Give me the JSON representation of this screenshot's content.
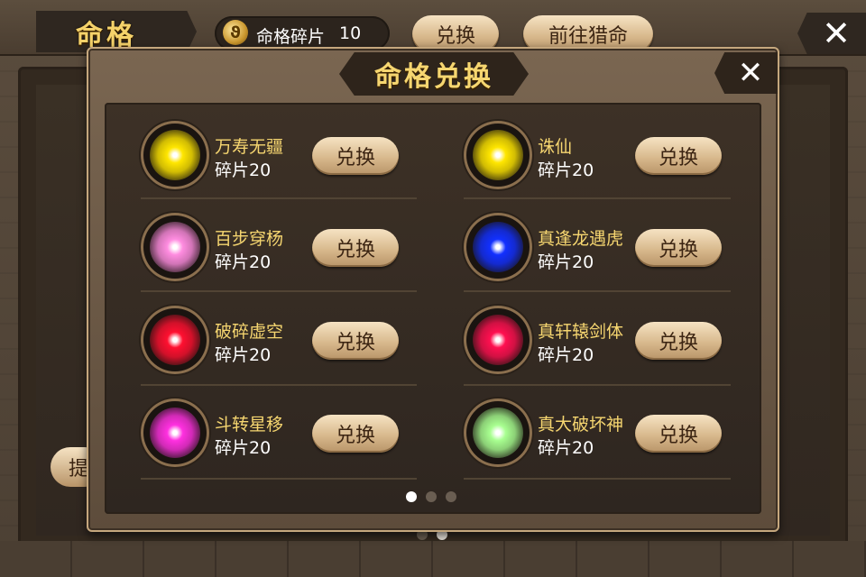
{
  "header": {
    "title": "命格",
    "fragments_label": "命格碎片",
    "fragments_value": "10",
    "fragment_icon": "swirl-coin-icon",
    "exchange_label": "兑换",
    "hunt_label": "前往猎命",
    "close_glyph": "✕"
  },
  "background": {
    "tip_label": "提",
    "pager": [
      false,
      true
    ]
  },
  "modal": {
    "title": "命格兑换",
    "close_glyph": "✕",
    "items": [
      {
        "name": "万寿无疆",
        "cost": "碎片20",
        "button": "兑换",
        "color": "#ffe600"
      },
      {
        "name": "诛仙",
        "cost": "碎片20",
        "button": "兑换",
        "color": "#ffe600"
      },
      {
        "name": "百步穿杨",
        "cost": "碎片20",
        "button": "兑换",
        "color": "#ff8ce0"
      },
      {
        "name": "真逢龙遇虎",
        "cost": "碎片20",
        "button": "兑换",
        "color": "#1230ff"
      },
      {
        "name": "破碎虚空",
        "cost": "碎片20",
        "button": "兑换",
        "color": "#ff1030"
      },
      {
        "name": "真轩辕剑体",
        "cost": "碎片20",
        "button": "兑换",
        "color": "#ff1050"
      },
      {
        "name": "斗转星移",
        "cost": "碎片20",
        "button": "兑换",
        "color": "#ff30e0"
      },
      {
        "name": "真大破坏神",
        "cost": "碎片20",
        "button": "兑换",
        "color": "#a8ff90"
      }
    ],
    "pager": [
      true,
      false,
      false
    ]
  }
}
